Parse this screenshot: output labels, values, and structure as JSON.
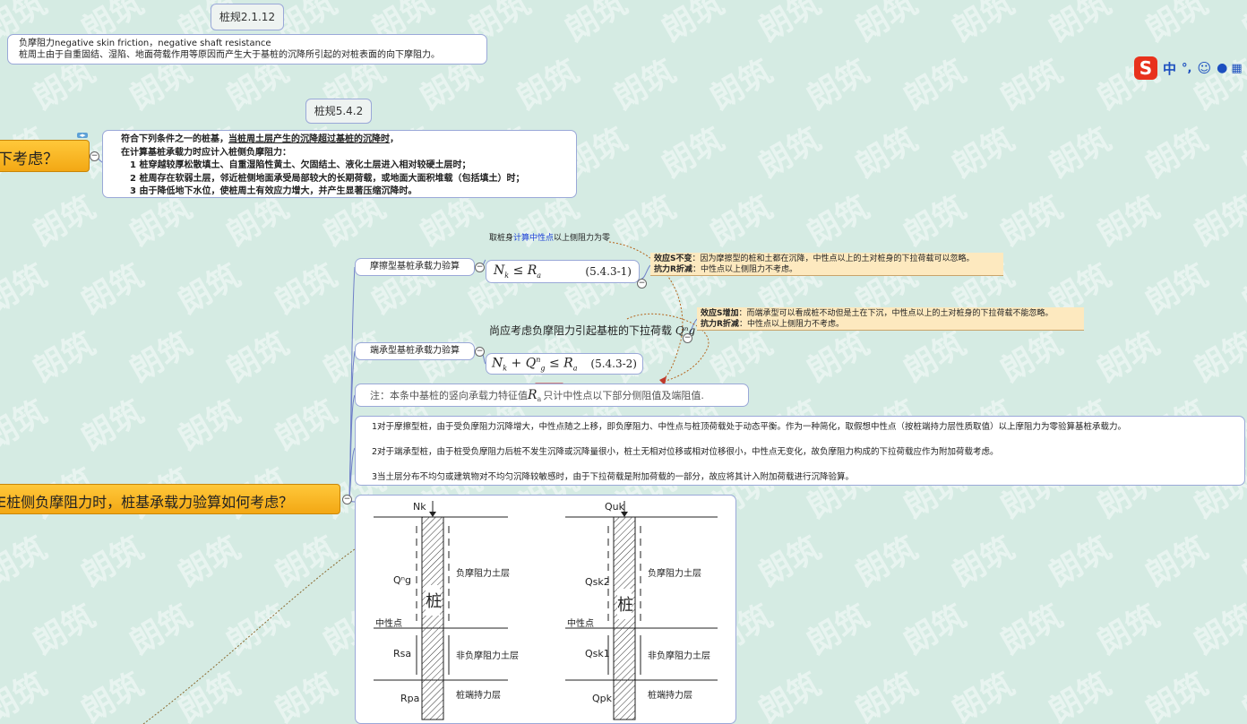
{
  "tags": {
    "code_2112": "桩规2.1.12",
    "code_542": "桩规5.4.2"
  },
  "definition": {
    "line1": "负摩阻力negative skin friction，negative shaft resistance",
    "line2": "桩周土由于自重固结、湿陷、地面荷载作用等原因而产生大于基桩的沉降所引起的对桩表面的向下摩阻力。"
  },
  "condition_box": {
    "line1_a": "符合下列条件之一的桩基，",
    "line1_u": "当桩周土层产生的沉降超过基桩的沉降时",
    "line1_b": "，",
    "line2": "在计算基桩承载力时应计入桩侧负摩阻力：",
    "item1": "1 桩穿越较厚松散填土、自重湿陷性黄土、欠固结土、液化土层进入相对较硬土层时；",
    "item2": "2 桩周存在软弱土层，邻近桩侧地面承受局部较大的长期荷载，或地面大面积堆载（包括填土）时；",
    "item3": "3 由于降低地下水位，使桩周土有效应力增大，并产生显著压缩沉降时。"
  },
  "topics": {
    "topic1": "下考虑？",
    "topic2": "E桩侧负摩阻力时，桩基承载力验算如何考虑？"
  },
  "friction_pile": {
    "label": "摩擦型基桩承载力验算",
    "caption_a": "取桩身",
    "caption_link": "计算中性点",
    "caption_b": "以上侧阻力为零",
    "formula_lhs": "N",
    "formula_sub": "k",
    "formula_op": "≤",
    "formula_rhs": "R",
    "formula_rsub": "a",
    "formula_no": "(5.4.3-1)"
  },
  "note1": {
    "s_label": "效应S不变",
    "s_text": "：因为摩擦型的桩和土都在沉降，中性点以上的土对桩身的下拉荷载可以忽略。",
    "r_label": "抗力R折减",
    "r_text": "：中性点以上侧阻力不考虑。"
  },
  "end_pile": {
    "label": "端承型基桩承载力验算",
    "caption": "尚应考虑负摩阻力引起基桩的下拉荷载",
    "caption_sym": "Qⁿg",
    "formula_text": "N",
    "formula_no": "(5.4.3-2)"
  },
  "note2": {
    "s_label": "效应S增加",
    "s_text": "：而端承型可以看成桩不动但是土在下沉，中性点以上的土对桩身的下拉荷载不能忽略。",
    "r_label": "抗力R折减",
    "r_text": "：中性点以上侧阻力不考虑。"
  },
  "remark": {
    "prefix": "注：本条中基桩的竖向承载力特征值",
    "sym": "R",
    "sym_sub": "a",
    "suffix": "只计中性点以下部分侧阻值及端阻值."
  },
  "explain": {
    "p1": "1对于摩擦型桩，由于受负摩阻力沉降增大，中性点随之上移，即负摩阻力、中性点与桩顶荷载处于动态平衡。作为一种简化，取假想中性点（按桩端持力层性质取值）以上摩阻力为零验算基桩承载力。",
    "p2": "2对于端承型桩，由于桩受负摩阻力后桩不发生沉降或沉降量很小，桩土无相对位移或相对位移很小，中性点无变化，故负摩阻力构成的下拉荷载应作为附加荷载考虑。",
    "p3": "3当土层分布不均匀或建筑物对不均匀沉降较敏感时，由于下拉荷载是附加荷载的一部分，故应将其计入附加荷载进行沉降验算。"
  },
  "diagram": {
    "left": {
      "top_load": "Nk",
      "neg_force": "Qⁿg",
      "neutral": "中性点",
      "pile": "桩",
      "side_res": "Rsa",
      "tip_res": "Rpa",
      "layer1": "负摩阻力土层",
      "layer2": "非负摩阻力土层",
      "layer3": "桩端持力层"
    },
    "right": {
      "top_load": "Quk",
      "neg_force": "Qsk2",
      "neutral": "中性点",
      "pile": "桩",
      "side_res": "Qsk1",
      "tip_res": "Qpk",
      "layer1": "负摩阻力土层",
      "layer2": "非负摩阻力土层",
      "layer3": "桩端持力层"
    }
  },
  "ime": {
    "logo": "S",
    "mode": "中",
    "punct": "°,"
  },
  "watermark": "朗筑",
  "colors": {
    "background": "#d5ebe3",
    "topic_orange": "#f3a814",
    "note_fill": "#fde9bf",
    "box_border": "#9aa8d8",
    "link_blue": "#1a3fd6",
    "mark_red": "#d42020"
  }
}
